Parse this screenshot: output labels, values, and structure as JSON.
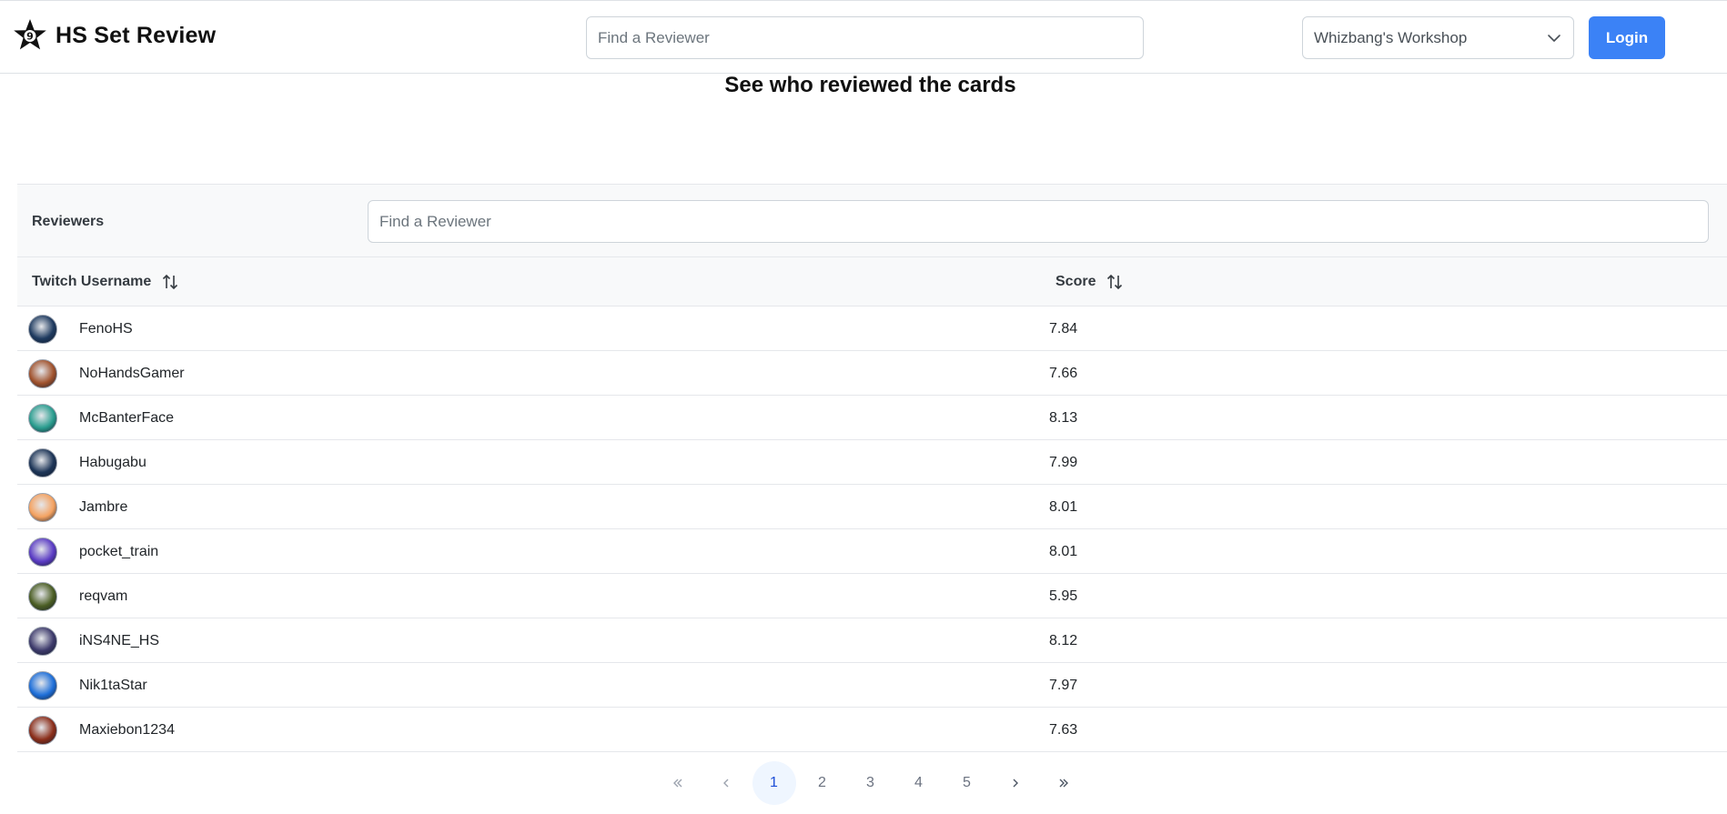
{
  "brand": {
    "title": "HS Set Review",
    "icon": "star-logo-icon"
  },
  "header": {
    "search_placeholder": "Find a Reviewer",
    "set_select": {
      "value": "Whizbang's Workshop",
      "icon": "chevron-down-icon"
    },
    "login_label": "Login"
  },
  "page": {
    "title": "See who reviewed the cards"
  },
  "reviewers": {
    "label": "Reviewers",
    "search_placeholder": "Find a Reviewer",
    "columns": {
      "username": "Twitch Username",
      "score": "Score"
    },
    "rows": [
      {
        "username": "FenoHS",
        "score": "7.84",
        "avatar_color": "#1e3a5f"
      },
      {
        "username": "NoHandsGamer",
        "score": "7.66",
        "avatar_color": "#a0522d"
      },
      {
        "username": "McBanterFace",
        "score": "8.13",
        "avatar_color": "#2a9d8f"
      },
      {
        "username": "Habugabu",
        "score": "7.99",
        "avatar_color": "#1d3557"
      },
      {
        "username": "Jambre",
        "score": "8.01",
        "avatar_color": "#f4a261"
      },
      {
        "username": "pocket_train",
        "score": "8.01",
        "avatar_color": "#5b3cc4"
      },
      {
        "username": "reqvam",
        "score": "5.95",
        "avatar_color": "#4a5d23"
      },
      {
        "username": "iNS4NE_HS",
        "score": "8.12",
        "avatar_color": "#3d3a6b"
      },
      {
        "username": "Nik1taStar",
        "score": "7.97",
        "avatar_color": "#1e6fd9"
      },
      {
        "username": "Maxiebon1234",
        "score": "7.63",
        "avatar_color": "#8b2e1a"
      }
    ]
  },
  "pagination": {
    "pages": [
      "1",
      "2",
      "3",
      "4",
      "5"
    ],
    "current": "1"
  },
  "colors": {
    "accent": "#3b82f6",
    "active_page_bg": "#eff6ff"
  }
}
